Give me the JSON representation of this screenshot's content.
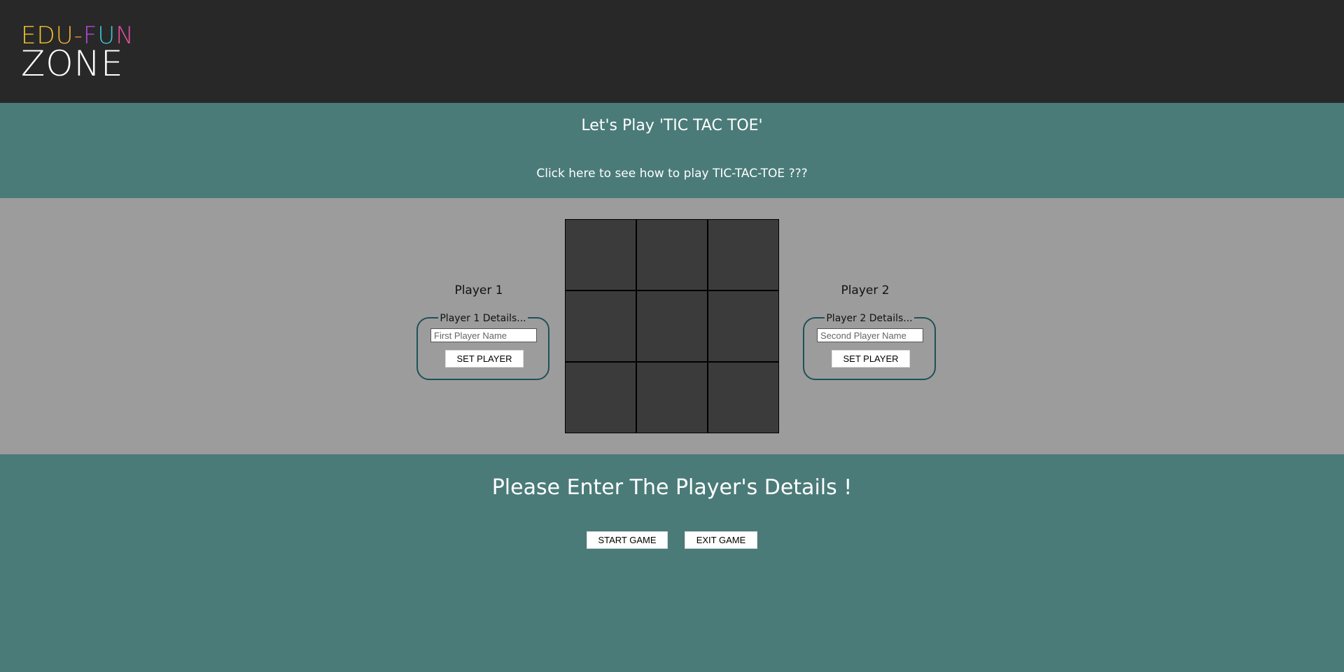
{
  "logo": {
    "top_letters": [
      {
        "ch": "E",
        "color": "#f2c230"
      },
      {
        "ch": "D",
        "color": "#f2c230"
      },
      {
        "ch": "U",
        "color": "#f2b233"
      },
      {
        "ch": "-",
        "color": "#f08a3a"
      },
      {
        "ch": "F",
        "color": "#b04ad8"
      },
      {
        "ch": "U",
        "color": "#3fc6d8"
      },
      {
        "ch": "N",
        "color": "#e0509e"
      }
    ],
    "bottom": "ZONE"
  },
  "header": {
    "title": "Let's Play 'TIC TAC TOE'",
    "howto_link": "Click here to see how to play TIC-TAC-TOE ???"
  },
  "players": [
    {
      "label": "Player 1",
      "legend": "Player 1 Details...",
      "input_placeholder": "First Player Name",
      "input_value": "",
      "button": "SET PLAYER"
    },
    {
      "label": "Player 2",
      "legend": "Player 2 Details...",
      "input_placeholder": "Second Player Name",
      "input_value": "",
      "button": "SET PLAYER"
    }
  ],
  "board": {
    "cells": [
      "",
      "",
      "",
      "",
      "",
      "",
      "",
      "",
      ""
    ]
  },
  "status": "Please Enter The Player's Details !",
  "controls": {
    "start": "START GAME",
    "exit": "EXIT GAME"
  },
  "colors": {
    "header_bg": "#282828",
    "teal": "#4a7b78",
    "play_bg": "#9c9c9c",
    "cell_bg": "#3b3b3b",
    "box_border": "#1e5257"
  }
}
